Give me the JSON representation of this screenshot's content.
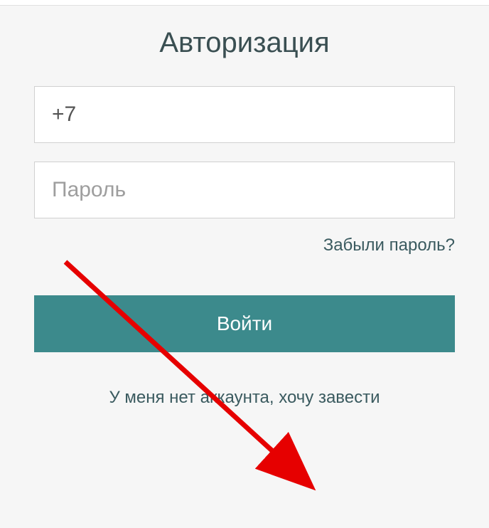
{
  "form": {
    "title": "Авторизация",
    "phone_value": "+7",
    "password_placeholder": "Пароль",
    "forgot_password": "Забыли пароль?",
    "login_button": "Войти",
    "register_link": "У меня нет аккаунта, хочу завести"
  },
  "colors": {
    "accent": "#3c8a8c",
    "text_dark": "#3a4f52",
    "arrow": "#e60000"
  }
}
